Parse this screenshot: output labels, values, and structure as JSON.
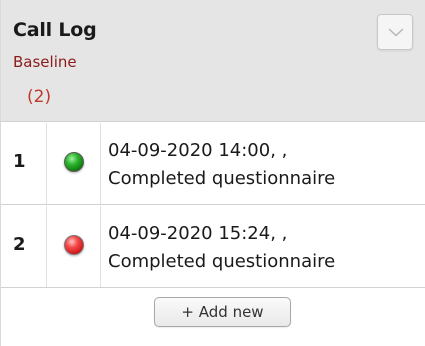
{
  "header": {
    "title": "Call Log",
    "subtitle": "Baseline",
    "count": "(2)"
  },
  "rows": [
    {
      "number": "1",
      "status": "green",
      "line1": "04-09-2020 14:00, ,",
      "line2": "Completed questionnaire"
    },
    {
      "number": "2",
      "status": "red",
      "line1": "04-09-2020 15:24, ,",
      "line2": "Completed questionnaire"
    }
  ],
  "footer": {
    "add_label": "+ Add new"
  },
  "colors": {
    "header_bg": "#e5e5e5",
    "subtitle": "#8a1c1c",
    "count": "#c0392b",
    "status_green": "#1a9a1a",
    "status_red": "#e22b2b"
  },
  "icons": {
    "dropdown": "chevron-down-icon",
    "status_complete": "green-status-dot-icon",
    "status_incomplete": "red-status-dot-icon"
  }
}
